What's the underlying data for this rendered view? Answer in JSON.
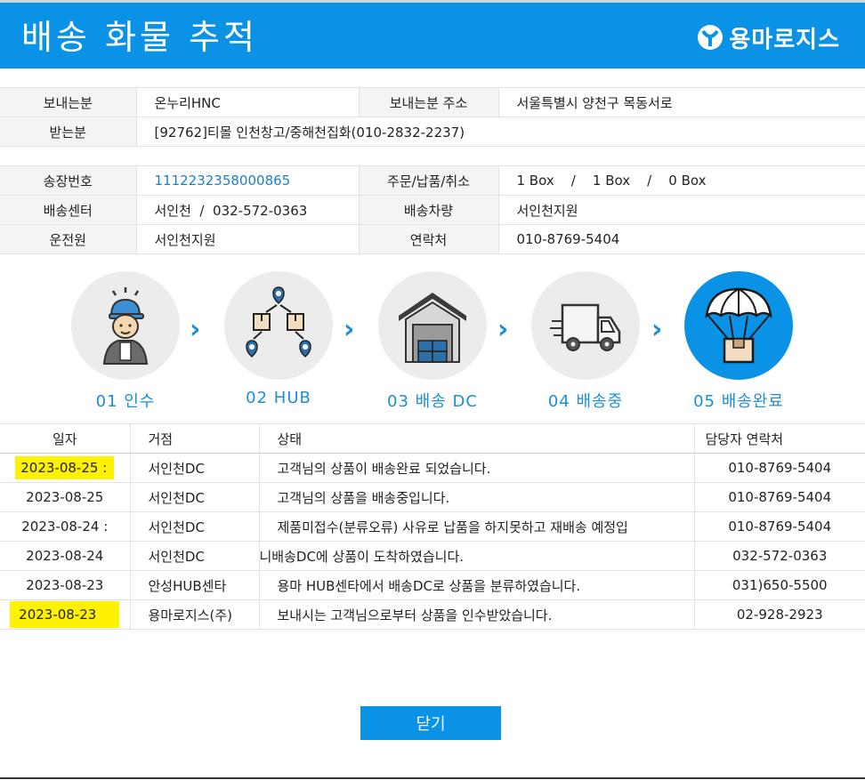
{
  "header": {
    "title": "배송 화물 추적",
    "brand": "용마로지스"
  },
  "sender": {
    "sender_label": "보내는분",
    "sender_value": "온누리HNC",
    "address_label": "보내는분 주소",
    "address_value": "서울특별시 양천구 목동서로",
    "receiver_label": "받는분",
    "receiver_value": "[92762]티몰 인천창고/중해천집화(010-2832-2237)"
  },
  "shipment": {
    "invoice_label": "송장번호",
    "invoice_value": "1112232358000865",
    "order_label": "주문/납품/취소",
    "order_value": "1 Box    /    1 Box    /    0 Box",
    "center_label": "배송센터",
    "center_value": "서인천  /  032-572-0363",
    "vehicle_label": "배송차량",
    "vehicle_value": "서인천지원",
    "driver_label": "운전원",
    "driver_value": "서인천지원",
    "contact_label": "연락처",
    "contact_value": "010-8769-5404"
  },
  "steps": [
    {
      "label": "01 인수",
      "icon": "worker-icon",
      "active": false
    },
    {
      "label": "02 HUB",
      "icon": "hub-icon",
      "active": false
    },
    {
      "label": "03 배송 DC",
      "icon": "warehouse-icon",
      "active": false
    },
    {
      "label": "04 배송중",
      "icon": "truck-icon",
      "active": false
    },
    {
      "label": "05 배송완료",
      "icon": "parachute-box-icon",
      "active": true
    }
  ],
  "history": {
    "headers": [
      "일자",
      "거점",
      "상태",
      "담당자 연락처"
    ],
    "rows": [
      {
        "date": "2023-08-25 :",
        "site": "서인천DC",
        "status": "고객님의 상품이 배송완료 되었습니다.",
        "phone": "010-8769-5404",
        "highlight": true
      },
      {
        "date": "2023-08-25",
        "site": "서인천DC",
        "status": "고객님의 상품을 배송중입니다.",
        "phone": "010-8769-5404",
        "highlight": false
      },
      {
        "date": "2023-08-24 :",
        "site": "서인천DC",
        "status": "제품미접수(분류오류) 사유로 납품을 하지못하고 재배송 예정입",
        "phone": "010-8769-5404",
        "highlight": false
      },
      {
        "date": "2023-08-24",
        "site": "서인천DC",
        "status": "니배송DC에 상품이 도착하였습니다.",
        "phone": "032-572-0363",
        "highlight": false
      },
      {
        "date": "2023-08-23",
        "site": "안성HUB센타",
        "status": "용마 HUB센타에서 배송DC로 상품을 분류하였습니다.",
        "phone": "031)650-5500",
        "highlight": false
      },
      {
        "date": "2023-08-23",
        "site": "용마로지스(주)",
        "status": "보내시는 고객님으로부터 상품을 인수받았습니다.",
        "phone": "02-928-2923",
        "highlight": true
      }
    ]
  },
  "close_label": "닫기",
  "colors": {
    "primary": "#0a93e6",
    "highlight": "#fff200",
    "step_bg": "#ececec"
  }
}
